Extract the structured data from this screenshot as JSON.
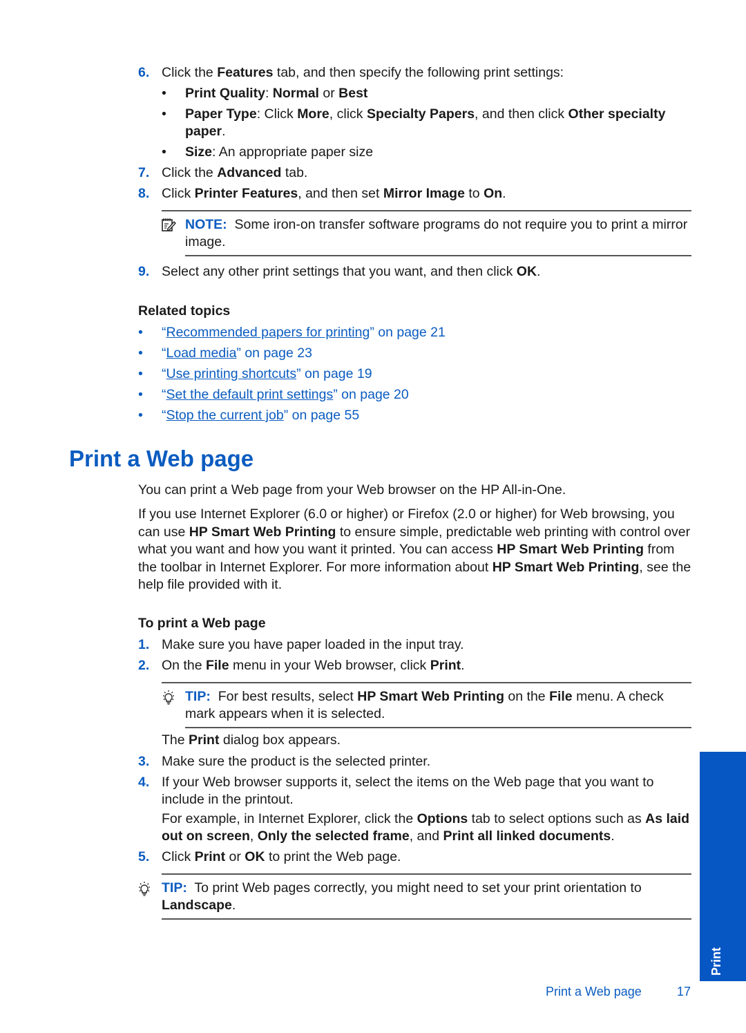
{
  "steps_top": [
    {
      "number": "6.",
      "parts": [
        [
          "Click the ",
          false
        ],
        [
          "Features",
          true
        ],
        [
          " tab, and then specify the following print settings:",
          false
        ]
      ]
    },
    {
      "number": "7.",
      "parts": [
        [
          "Click the ",
          false
        ],
        [
          "Advanced",
          true
        ],
        [
          " tab.",
          false
        ]
      ]
    },
    {
      "number": "8.",
      "parts": [
        [
          "Click ",
          false
        ],
        [
          "Printer Features",
          true
        ],
        [
          ", and then set ",
          false
        ],
        [
          "Mirror Image",
          true
        ],
        [
          " to ",
          false
        ],
        [
          "On",
          true
        ],
        [
          ".",
          false
        ]
      ]
    },
    {
      "number": "9.",
      "parts": [
        [
          "Select any other print settings that you want, and then click ",
          false
        ],
        [
          "OK",
          true
        ],
        [
          ".",
          false
        ]
      ]
    }
  ],
  "step6_bullets": [
    {
      "bullet": "•",
      "parts": [
        [
          "Print Quality",
          true
        ],
        [
          ": ",
          false
        ],
        [
          "Normal",
          true
        ],
        [
          " or ",
          false
        ],
        [
          "Best",
          true
        ]
      ]
    },
    {
      "bullet": "•",
      "parts": [
        [
          "Paper Type",
          true
        ],
        [
          ": Click ",
          false
        ],
        [
          "More",
          true
        ],
        [
          ", click ",
          false
        ],
        [
          "Specialty Papers",
          true
        ],
        [
          ", and then click ",
          false
        ],
        [
          "Other specialty paper",
          true
        ],
        [
          ".",
          false
        ]
      ]
    },
    {
      "bullet": "•",
      "parts": [
        [
          "Size",
          true
        ],
        [
          ": An appropriate paper size",
          false
        ]
      ]
    }
  ],
  "note": {
    "icon": "note-pencil-icon",
    "label": "NOTE:",
    "text": "Some iron-on transfer software programs do not require you to print a mirror image."
  },
  "related": {
    "heading": "Related topics",
    "items": [
      {
        "bullet": "•",
        "open_quote": "“",
        "link": "Recommended papers for printing",
        "suffix": "” on page 21"
      },
      {
        "bullet": "•",
        "open_quote": "“",
        "link": "Load media",
        "suffix": "” on page 23"
      },
      {
        "bullet": "•",
        "open_quote": "“",
        "link": "Use printing shortcuts",
        "suffix": "” on page 19"
      },
      {
        "bullet": "•",
        "open_quote": "“",
        "link": "Set the default print settings",
        "suffix": "” on page 20"
      },
      {
        "bullet": "•",
        "open_quote": "“",
        "link": "Stop the current job",
        "suffix": "” on page 55"
      }
    ]
  },
  "section": {
    "title": "Print a Web page",
    "intro": "You can print a Web page from your Web browser on the HP All-in-One.",
    "para2": [
      [
        "If you use Internet Explorer (6.0 or higher) or Firefox (2.0 or higher) for Web browsing, you can use ",
        false
      ],
      [
        "HP Smart Web Printing",
        true
      ],
      [
        " to ensure simple, predictable web printing with control over what you want and how you want it printed. You can access ",
        false
      ],
      [
        "HP Smart Web Printing",
        true
      ],
      [
        " from the toolbar in Internet Explorer. For more information about ",
        false
      ],
      [
        "HP Smart Web Printing",
        true
      ],
      [
        ", see the help file provided with it.",
        false
      ]
    ],
    "procedure_heading": "To print a Web page",
    "steps": [
      {
        "number": "1.",
        "parts": [
          [
            "Make sure you have paper loaded in the input tray.",
            false
          ]
        ]
      },
      {
        "number": "2.",
        "parts": [
          [
            "On the ",
            false
          ],
          [
            "File",
            true
          ],
          [
            " menu in your Web browser, click ",
            false
          ],
          [
            "Print",
            true
          ],
          [
            ".",
            false
          ]
        ]
      },
      {
        "number": "3.",
        "parts": [
          [
            "Make sure the product is the selected printer.",
            false
          ]
        ]
      },
      {
        "number": "4.",
        "parts": [
          [
            "If your Web browser supports it, select the items on the Web page that you want to include in the printout.",
            false
          ]
        ]
      },
      {
        "number": "5.",
        "parts": [
          [
            "Click ",
            false
          ],
          [
            "Print",
            true
          ],
          [
            " or ",
            false
          ],
          [
            "OK",
            true
          ],
          [
            " to print the Web page.",
            false
          ]
        ]
      }
    ],
    "tip1": {
      "icon": "lightbulb-icon",
      "label": "TIP:",
      "parts": [
        [
          "For best results, select ",
          false
        ],
        [
          "HP Smart Web Printing",
          true
        ],
        [
          " on the ",
          false
        ],
        [
          "File",
          true
        ],
        [
          " menu. A check mark appears when it is selected.",
          false
        ]
      ]
    },
    "after_step2": [
      [
        "The ",
        false
      ],
      [
        "Print",
        true
      ],
      [
        " dialog box appears.",
        false
      ]
    ],
    "step4_extra": [
      [
        "For example, in Internet Explorer, click the ",
        false
      ],
      [
        "Options",
        true
      ],
      [
        " tab to select options such as ",
        false
      ],
      [
        "As laid out on screen",
        true
      ],
      [
        ", ",
        false
      ],
      [
        "Only the selected frame",
        true
      ],
      [
        ", and ",
        false
      ],
      [
        "Print all linked documents",
        true
      ],
      [
        ".",
        false
      ]
    ],
    "tip2": {
      "icon": "lightbulb-icon",
      "label": "TIP:",
      "parts": [
        [
          "To print Web pages correctly, you might need to set your print orientation to ",
          false
        ],
        [
          "Landscape",
          true
        ],
        [
          ".",
          false
        ]
      ]
    }
  },
  "side_tab": {
    "label": "Print",
    "color": "#0656c4"
  },
  "footer": {
    "section_title": "Print a Web page",
    "page_number": "17"
  }
}
